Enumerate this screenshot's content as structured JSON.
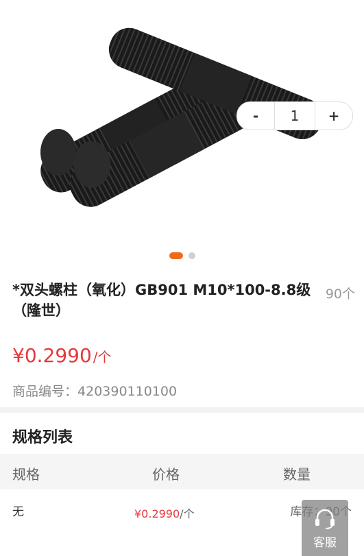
{
  "product": {
    "title": "*双头螺柱（氧化）GB901 M10*100-8.8级（隆世）",
    "unit_note": "90个",
    "price": "¥0.2990",
    "price_unit": "/个",
    "code_label": "商品编号：",
    "code": "420390110100"
  },
  "gallery": {
    "total": 2,
    "active_index": 0
  },
  "spec": {
    "title": "规格列表",
    "headers": [
      "规格",
      "价格",
      "数量"
    ],
    "rows": [
      {
        "spec": "无",
        "price": "¥0.2990",
        "price_unit": "/个",
        "stock": "库存：90个",
        "qty": "1"
      }
    ]
  },
  "stepper": {
    "minus": "-",
    "plus": "+"
  },
  "service": {
    "label": "客服"
  },
  "colors": {
    "accent": "#ee6a1a",
    "price": "#e4393c"
  }
}
